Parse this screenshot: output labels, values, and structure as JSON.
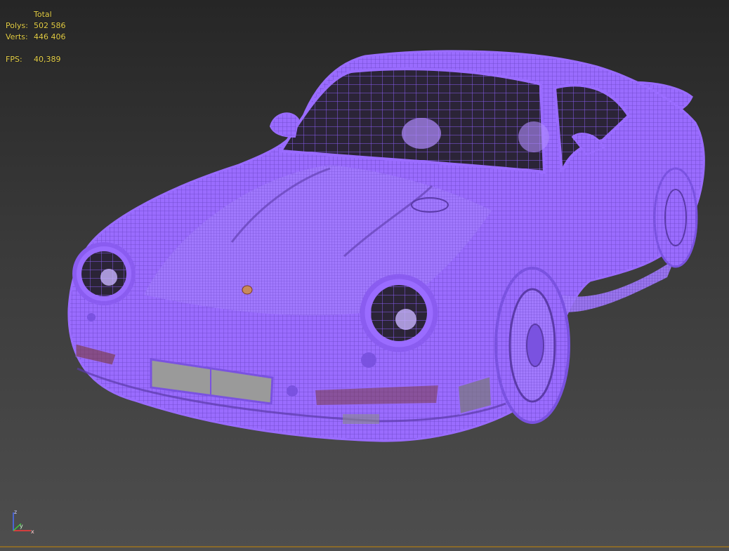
{
  "stats": {
    "header": "Total",
    "polys_label": "Polys:",
    "polys_value": "502 586",
    "verts_label": "Verts:",
    "verts_value": "446 406",
    "fps_label": "FPS:",
    "fps_value": "40,389"
  },
  "viewport": {
    "wire_color": "#9a6cff",
    "wire_line_color": "#5b3aa8",
    "background_top": "#262626",
    "background_bottom": "#4e4e4e",
    "stats_color": "#e8d24a"
  },
  "axis_gizmo": {
    "x_label": "x",
    "y_label": "y",
    "z_label": "z"
  }
}
